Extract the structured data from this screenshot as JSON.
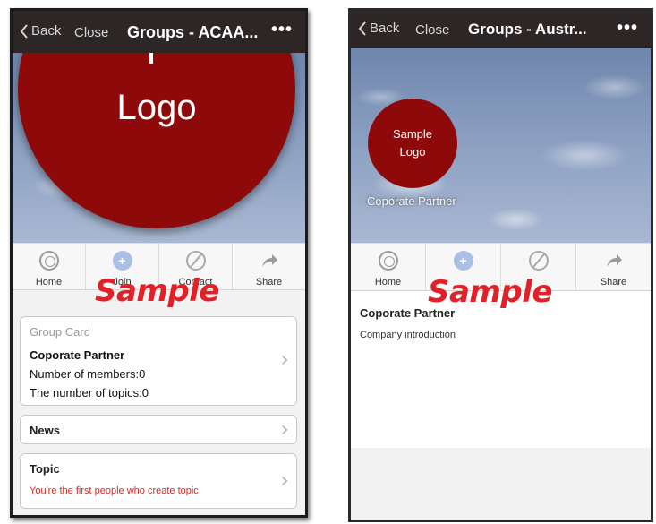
{
  "left_screen": {
    "nav": {
      "back": "Back",
      "close": "Close",
      "title": "Groups - ACAA...",
      "more": "•••"
    },
    "logo_text": "Logo",
    "tabs": [
      {
        "label": "Home",
        "icon": "home-icon"
      },
      {
        "label": "Join",
        "icon": "join-icon",
        "glyph": "+"
      },
      {
        "label": "Contact",
        "icon": "contact-icon"
      },
      {
        "label": "Share",
        "icon": "share-icon"
      }
    ],
    "watermark": "Sample",
    "group_card": {
      "header": "Group Card",
      "name": "Coporate Partner",
      "members": "Number of members:0",
      "topics": "The number of topics:0"
    },
    "news": {
      "title": "News"
    },
    "topic": {
      "title": "Topic",
      "subtitle": "You're the first people who create topic"
    },
    "chevron": "›"
  },
  "right_screen": {
    "nav": {
      "back": "Back",
      "close": "Close",
      "title": "Groups - Austr...",
      "more": "•••"
    },
    "logo_line1": "Sample",
    "logo_line2": "Logo",
    "banner_caption": "Coporate Partner",
    "tabs": [
      {
        "label": "Home",
        "icon": "home-icon"
      },
      {
        "label": "",
        "icon": "join-icon",
        "glyph": "+"
      },
      {
        "label": "",
        "icon": "contact-icon"
      },
      {
        "label": "Share",
        "icon": "share-icon"
      }
    ],
    "watermark": "Sample",
    "company_name": "Coporate Partner",
    "company_intro": "Company introduction"
  },
  "colors": {
    "nav_bg": "#2d2626",
    "logo_red": "#8e0a0a",
    "watermark_red": "#e12027",
    "topic_red": "#d02a2a"
  }
}
